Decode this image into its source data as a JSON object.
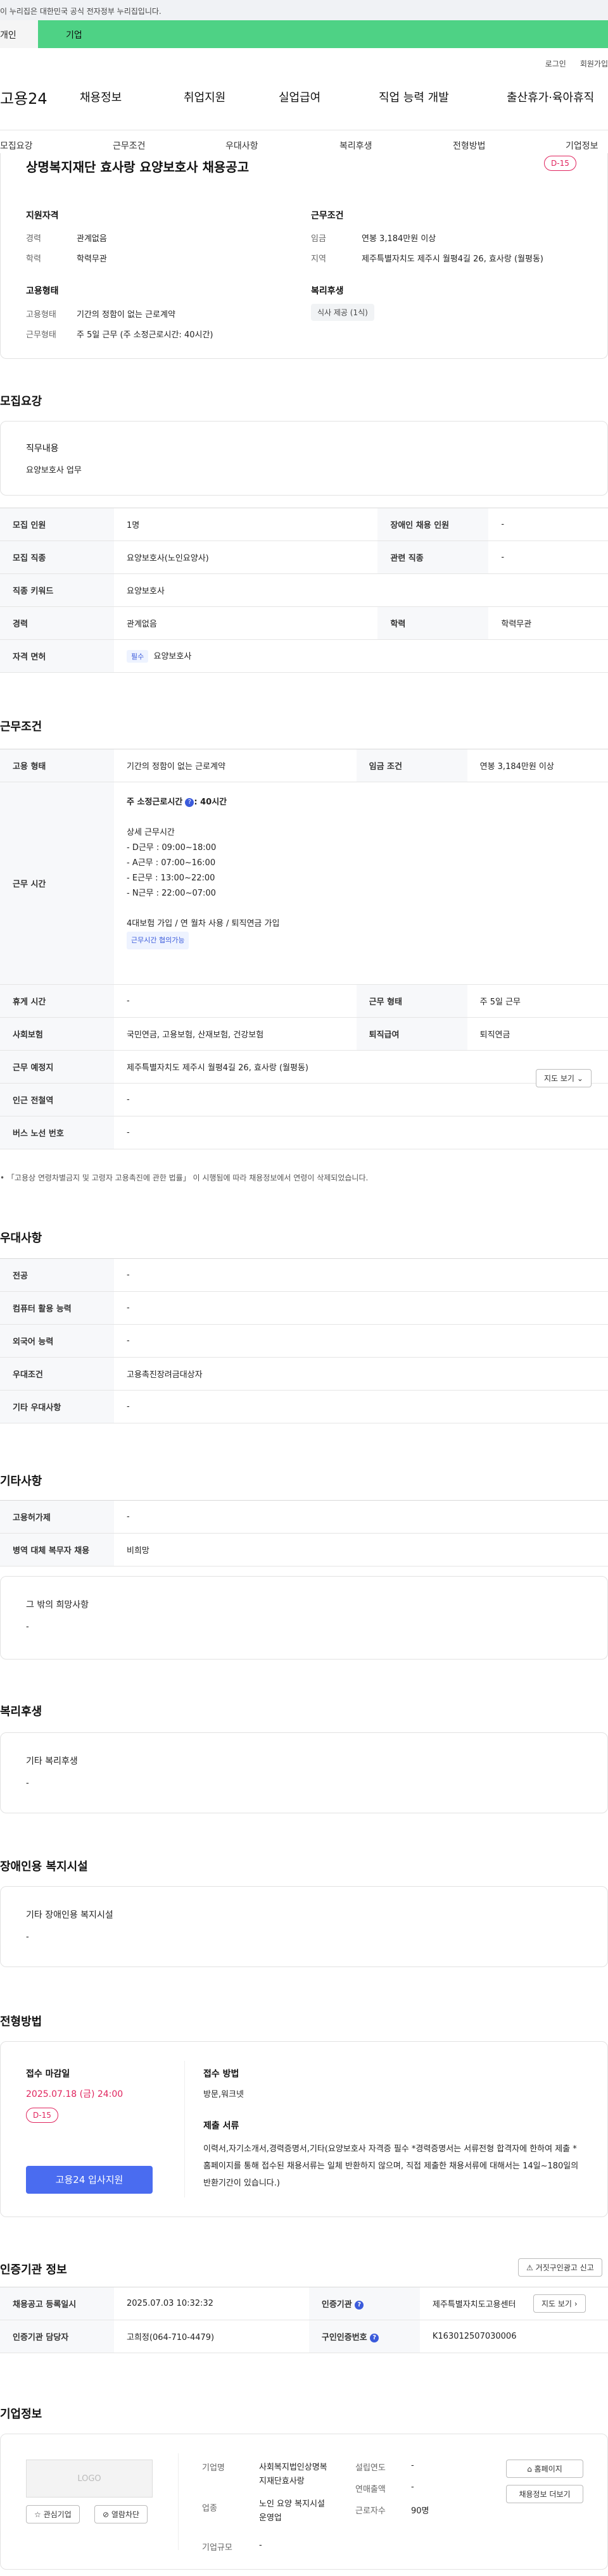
{
  "gov_banner": "이 누리집은 대한민국 공식 전자정부 누리집입니다.",
  "top_tabs": {
    "left": "개인",
    "right": "기업"
  },
  "util_links": [
    "로그인",
    "회원가입"
  ],
  "logo": "고용24",
  "gnb": [
    "채용정보",
    "취업지원",
    "실업급여",
    "직업 능력 개발",
    "출산휴가·육아휴직"
  ],
  "subnav": [
    "모집요강",
    "근무조건",
    "우대사항",
    "복리후생",
    "전형방법",
    "기업정보"
  ],
  "header": {
    "title": "상명복지재단 효사랑 요양보호사 채용공고",
    "dday": "D-15",
    "qualification_title": "지원자격",
    "career_label": "경력",
    "career_value": "관계없음",
    "education_label": "학력",
    "education_value": "학력무관",
    "work_cond_title": "근무조건",
    "wage_label": "임금",
    "wage_value": "연봉 3,184만원 이상",
    "region_label": "지역",
    "region_value": "제주특별자치도 제주시 월평4길 26, 효사랑 (월평동)",
    "employment_title": "고용형태",
    "emp_type_label": "고용형태",
    "emp_type_value": "기간의 정함이 없는 근로계약",
    "work_form_label": "근무형태",
    "work_form_value": "주 5일 근무 (주 소정근로시간: 40시간)",
    "welfare_title": "복리후생",
    "welfare_chip": "식사 제공 (1식)"
  },
  "recruit": {
    "section_title": "모집요강",
    "job_content_label": "직무내용",
    "job_content_value": "요양보호사 업무",
    "rows": [
      [
        "모집 인원",
        "1명",
        "장애인 채용 인원",
        "-"
      ],
      [
        "모집 직종",
        "요양보호사(노인요양사)",
        "관련 직종",
        "-"
      ],
      [
        "직종 키워드",
        "요양보호사"
      ],
      [
        "경력",
        "관계없음",
        "학력",
        "학력무관"
      ],
      [
        "자격 면허",
        "요양보호사"
      ]
    ],
    "required_tag": "필수"
  },
  "work": {
    "section_title": "근무조건",
    "emp_type_label": "고용 형태",
    "emp_type_value": "기간의 정함이 없는 근로계약",
    "wage_label": "임금 조건",
    "wage_value": "연봉 3,184만원 이상",
    "hours_label": "근무 시간",
    "hours_main": "주 소정근로시간",
    "hours_total": ": 40시간",
    "hours_detail_title": "상세 근무시간",
    "hours_lines": [
      "- D근무 : 09:00~18:00",
      "- A근무 : 07:00~16:00",
      "- E근무 : 13:00~22:00",
      "- N근무 : 22:00~07:00"
    ],
    "insurance_note": "4대보험 가입 / 연 월차 사용 / 퇴직연금 가입",
    "hours_tag": "근무시간 협의가능",
    "rest_label": "휴게 시간",
    "rest_value": "-",
    "form_label": "근무 형태",
    "form_value": "주 5일 근무",
    "social_label": "사회보험",
    "social_value": "국민연금, 고용보험, 산재보험, 건강보험",
    "severance_label": "퇴직급여",
    "severance_value": "퇴직연금",
    "place_label": "근무 예정지",
    "place_value": "제주특별자치도 제주시 월평4길 26, 효사랑 (월평동)",
    "map_btn": "지도 보기",
    "station_label": "인근 전철역",
    "station_value": "-",
    "bus_label": "버스 노선 번호",
    "bus_value": "-",
    "footnote": "「고용상 연령차별금지 및 고령자 고용촉진에 관한 법률」 이 시행됨에 따라 채용정보에서 연령이 삭제되었습니다."
  },
  "pref": {
    "section_title": "우대사항",
    "rows": [
      [
        "전공",
        "-"
      ],
      [
        "컴퓨터 활용 능력",
        "-"
      ],
      [
        "외국어 능력",
        "-"
      ],
      [
        "우대조건",
        "고용촉진장려금대상자"
      ],
      [
        "기타 우대사항",
        "-"
      ]
    ]
  },
  "etc": {
    "section_title": "기타사항",
    "rows": [
      [
        "고용허가제",
        "-"
      ],
      [
        "병역 대체 복무자 채용",
        "비희망"
      ]
    ],
    "other_label": "그 밖의 희망사항",
    "other_value": "-"
  },
  "welfare": {
    "section_title": "복리후생",
    "label": "기타 복리후생",
    "value": "-"
  },
  "disability": {
    "section_title": "장애인용 복지시설",
    "label": "기타 장애인용 복지시설",
    "value": "-"
  },
  "selection": {
    "section_title": "전형방법",
    "deadline_label": "접수 마감일",
    "deadline_value": "2025.07.18 (금) 24:00",
    "dday": "D-15",
    "method_label": "접수 방법",
    "method_value": "방문,워크넷",
    "docs_label": "제출 서류",
    "docs_value": "이력서,자기소개서,경력증명서,기타(요양보호사 자격증 필수 *경력증명서는 서류전형 합격자에 한하여 제출 *홈페이지를 통해 접수된 채용서류는 일체 반환하지 않으며, 직접 제출한 채용서류에 대해서는 14일~180일의 반환기간이 있습니다.)",
    "apply_btn": "고용24 입사지원"
  },
  "cert": {
    "section_title": "인증기관 정보",
    "report_btn": "거짓구인광고 신고",
    "reg_date_label": "채용공고 등록일시",
    "reg_date_value": "2025.07.03 10:32:32",
    "agency_label": "인증기관",
    "agency_value": "제주특별자치도고용센터",
    "map_btn": "지도 보기",
    "manager_label": "인증기관 담당자",
    "manager_value": "고희정(064-710-4479)",
    "job_no_label": "구인인증번호",
    "job_no_value": "K163012507030006"
  },
  "company": {
    "section_title": "기업정보",
    "logo_text": "LOGO",
    "fav_btn": "관심기업",
    "block_btn": "열람차단",
    "name_label": "기업명",
    "name_value": "사회복지법인상명복지재단효사랑",
    "industry_label": "업종",
    "industry_value": "노인 요양 복지시설 운영업",
    "size_label": "기업규모",
    "size_value": "-",
    "founded_label": "설립연도",
    "founded_value": "-",
    "revenue_label": "연매출액",
    "revenue_value": "-",
    "employees_label": "근로자수",
    "employees_value": "90명",
    "homepage_btn": "홈페이지",
    "more_btn": "채용정보 더보기"
  },
  "colors": {
    "accent": "#4a6cf0",
    "dday": "#e0245e",
    "green_tab": "#4ed285"
  }
}
